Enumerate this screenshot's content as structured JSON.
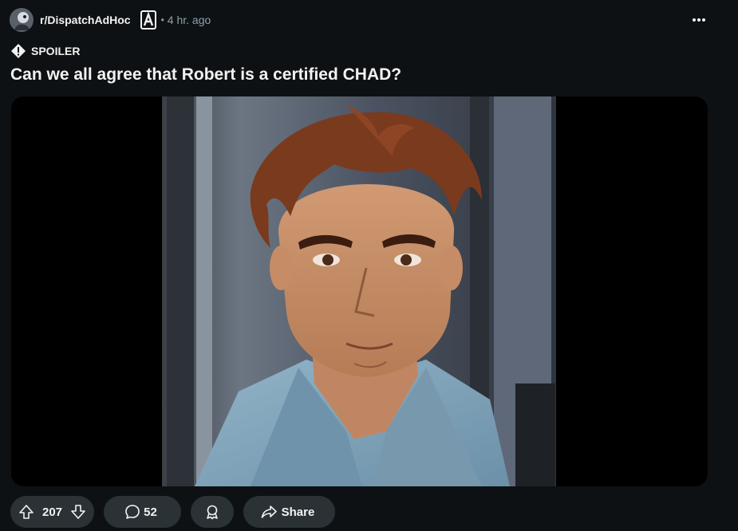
{
  "post": {
    "subreddit": "r/DispatchAdHoc",
    "separator": "•",
    "time": "4 hr. ago",
    "spoiler_label": "SPOILER",
    "title": "Can we all agree that Robert is a certified CHAD?"
  },
  "actions": {
    "upvotes": "207",
    "comments": "52",
    "share_label": "Share"
  },
  "colors": {
    "background": "#0e1113",
    "pill": "#2a3236",
    "text": "#f2f2f2",
    "muted": "#8ba2ad"
  },
  "icons": [
    "subreddit-avatar",
    "flair-a-icon",
    "more-options-icon",
    "spoiler-warning-icon",
    "upvote-icon",
    "downvote-icon",
    "comment-icon",
    "award-icon",
    "share-icon"
  ]
}
